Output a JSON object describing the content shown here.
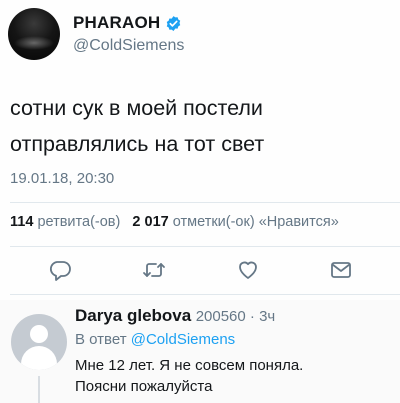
{
  "tweet": {
    "display_name": "PHARAOH",
    "handle": "@ColdSiemens",
    "text_line1": "сотни сук в моей постели",
    "text_line2": "отправлялись на тот свет",
    "time": "19.01.18, 20:30",
    "retweets_count": "114",
    "retweets_label": "ретвита(-ов)",
    "likes_count": "2 017",
    "likes_label": "отметки(-ок) «Нравится»"
  },
  "reply": {
    "name": "Darya glebova",
    "handle_time": "200560 · 3ч",
    "reply_prefix": "В ответ ",
    "reply_to": "@ColdSiemens",
    "text_line1": "Мне 12 лет.  Я не совсем поняла.",
    "text_line2": "Поясни пожалуйста"
  },
  "icons": {
    "verified": "verified-badge-icon",
    "reply": "reply-icon",
    "retweet": "retweet-icon",
    "like": "heart-icon",
    "share": "share-envelope-icon"
  },
  "colors": {
    "accent": "#1da1f2",
    "secondary_text": "#657786",
    "icon_gray": "#657786"
  }
}
